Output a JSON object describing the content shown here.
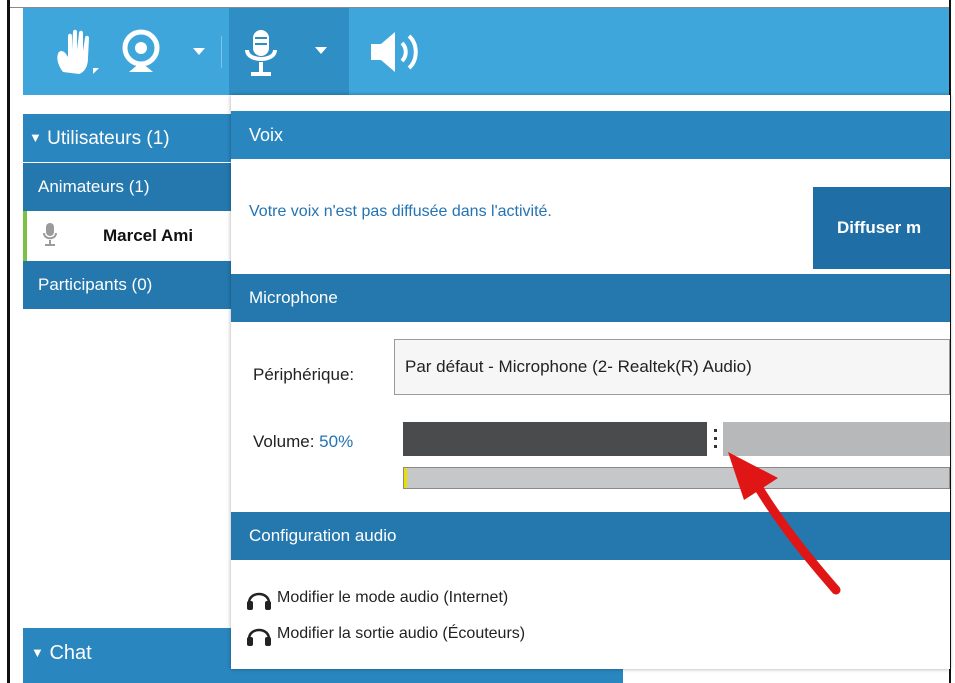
{
  "toolbar": {
    "buttons": [
      {
        "name": "raise-hand",
        "icon": "hand-icon"
      },
      {
        "name": "webcam",
        "icon": "webcam-icon"
      },
      {
        "name": "microphone",
        "icon": "microphone-icon",
        "active": true
      },
      {
        "name": "speaker",
        "icon": "speaker-icon"
      }
    ],
    "color": "#3fa6dc"
  },
  "sidebar": {
    "users_header": "Utilisateurs (1)",
    "animators_header": "Animateurs (1)",
    "user_name": "Marcel Ami",
    "participants_header": "Participants (0)",
    "chat_header": "Chat"
  },
  "voice_panel": {
    "title": "Voix",
    "status_message": "Votre voix n'est pas diffusée dans l'activité.",
    "broadcast_button": "Diffuser m",
    "microphone_section": "Microphone",
    "device_label": "Périphérique:",
    "device_value": "Par défaut - Microphone (2- Realtek(R) Audio)",
    "volume_label": "Volume:",
    "volume_value": "50%",
    "volume_level": 0.56,
    "input_level": 0.005,
    "audio_config_section": "Configuration audio",
    "link_audio_mode": "Modifier le mode audio (Internet)",
    "link_audio_output": "Modifier la sortie audio (Écouteurs)"
  },
  "colors": {
    "header_blue": "#2a86bf",
    "section_blue": "#2478ad",
    "link_blue": "#2473b3",
    "active_user": "#7cc242",
    "annotation_arrow": "#e01515"
  }
}
